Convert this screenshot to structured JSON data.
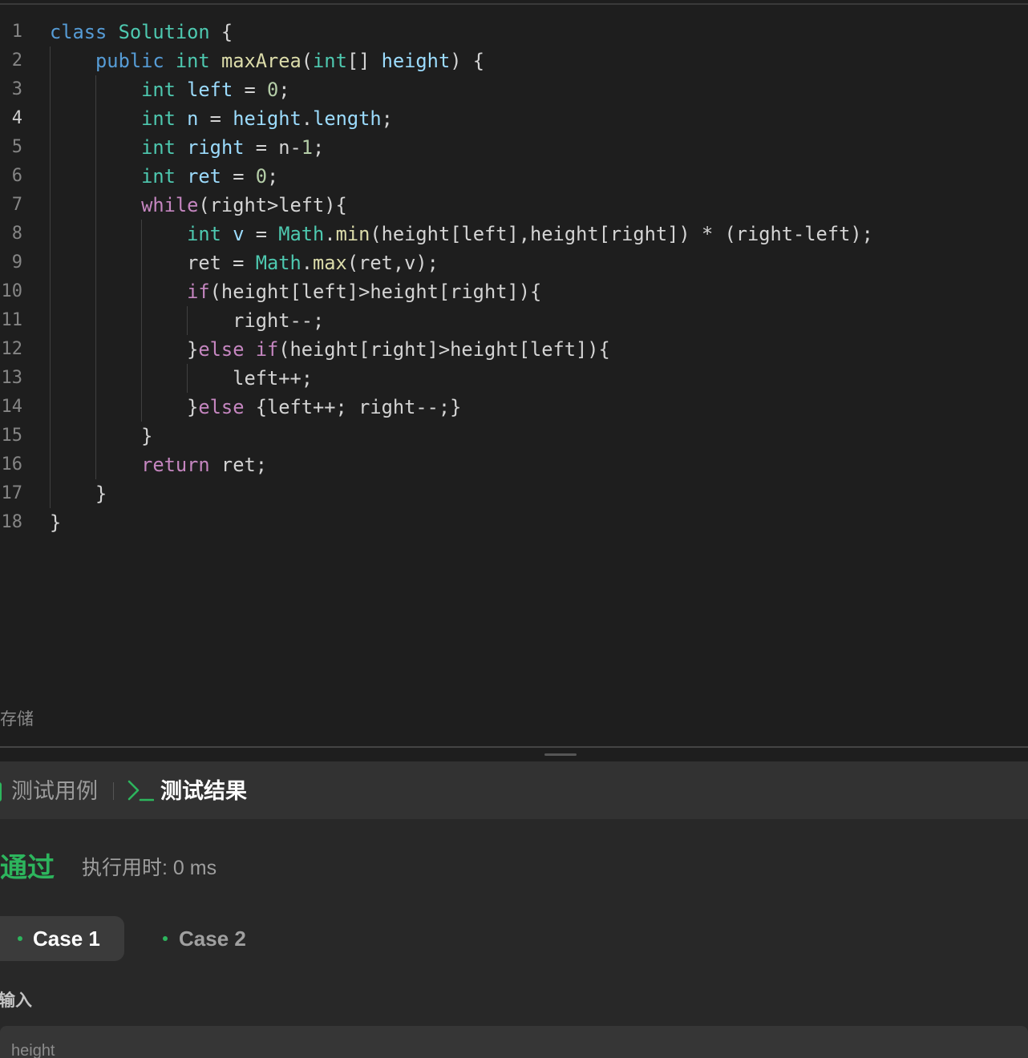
{
  "editor": {
    "line_numbers": [
      "1",
      "2",
      "3",
      "4",
      "5",
      "6",
      "7",
      "8",
      "9",
      "10",
      "11",
      "12",
      "13",
      "14",
      "15",
      "16",
      "17",
      "18"
    ],
    "active_line": 4,
    "lines": [
      [
        {
          "t": "class",
          "c": "keyword"
        },
        {
          "t": " "
        },
        {
          "t": "Solution",
          "c": "type"
        },
        {
          "t": " {"
        }
      ],
      [
        {
          "t": "    "
        },
        {
          "t": "public",
          "c": "keyword"
        },
        {
          "t": " "
        },
        {
          "t": "int",
          "c": "type"
        },
        {
          "t": " "
        },
        {
          "t": "maxArea",
          "c": "function"
        },
        {
          "t": "("
        },
        {
          "t": "int",
          "c": "type"
        },
        {
          "t": "[] "
        },
        {
          "t": "height",
          "c": "variable"
        },
        {
          "t": ") {"
        }
      ],
      [
        {
          "t": "        "
        },
        {
          "t": "int",
          "c": "type"
        },
        {
          "t": " "
        },
        {
          "t": "left",
          "c": "variable"
        },
        {
          "t": " = "
        },
        {
          "t": "0",
          "c": "number"
        },
        {
          "t": ";"
        }
      ],
      [
        {
          "t": "        "
        },
        {
          "t": "int",
          "c": "type"
        },
        {
          "t": " "
        },
        {
          "t": "n",
          "c": "variable"
        },
        {
          "t": " = "
        },
        {
          "t": "height",
          "c": "variable"
        },
        {
          "t": "."
        },
        {
          "t": "length",
          "c": "variable"
        },
        {
          "t": ";"
        }
      ],
      [
        {
          "t": "        "
        },
        {
          "t": "int",
          "c": "type"
        },
        {
          "t": " "
        },
        {
          "t": "right",
          "c": "variable"
        },
        {
          "t": " = n-"
        },
        {
          "t": "1",
          "c": "number"
        },
        {
          "t": ";"
        }
      ],
      [
        {
          "t": "        "
        },
        {
          "t": "int",
          "c": "type"
        },
        {
          "t": " "
        },
        {
          "t": "ret",
          "c": "variable"
        },
        {
          "t": " = "
        },
        {
          "t": "0",
          "c": "number"
        },
        {
          "t": ";"
        }
      ],
      [
        {
          "t": "        "
        },
        {
          "t": "while",
          "c": "control"
        },
        {
          "t": "(right>left){"
        }
      ],
      [
        {
          "t": "            "
        },
        {
          "t": "int",
          "c": "type"
        },
        {
          "t": " "
        },
        {
          "t": "v",
          "c": "variable"
        },
        {
          "t": " = "
        },
        {
          "t": "Math",
          "c": "type"
        },
        {
          "t": "."
        },
        {
          "t": "min",
          "c": "function"
        },
        {
          "t": "(height[left],height[right]) * (right-left);"
        }
      ],
      [
        {
          "t": "            ret = "
        },
        {
          "t": "Math",
          "c": "type"
        },
        {
          "t": "."
        },
        {
          "t": "max",
          "c": "function"
        },
        {
          "t": "(ret,v);"
        }
      ],
      [
        {
          "t": "            "
        },
        {
          "t": "if",
          "c": "control"
        },
        {
          "t": "(height[left]>height[right]){"
        }
      ],
      [
        {
          "t": "                right--;"
        }
      ],
      [
        {
          "t": "            }"
        },
        {
          "t": "else",
          "c": "control"
        },
        {
          "t": " "
        },
        {
          "t": "if",
          "c": "control"
        },
        {
          "t": "(height[right]>height[left]){"
        }
      ],
      [
        {
          "t": "                left++;"
        }
      ],
      [
        {
          "t": "            }"
        },
        {
          "t": "else",
          "c": "control"
        },
        {
          "t": " {left++; right--;}"
        }
      ],
      [
        {
          "t": "        }"
        }
      ],
      [
        {
          "t": "        "
        },
        {
          "t": "return",
          "c": "control"
        },
        {
          "t": " ret;"
        }
      ],
      [
        {
          "t": "    }"
        }
      ],
      [
        {
          "t": "}"
        }
      ]
    ]
  },
  "status_bar": {
    "save_label": "存储"
  },
  "result_panel": {
    "tabs": [
      {
        "label": "测试用例",
        "icon": "checkbox-icon",
        "active": false
      },
      {
        "label": "测试结果",
        "icon": "terminal-icon",
        "active": true
      }
    ],
    "verdict": "通过",
    "runtime": "执行用时: 0 ms",
    "cases": [
      {
        "label": "Case 1",
        "selected": true,
        "status": "passed"
      },
      {
        "label": "Case 2",
        "selected": false,
        "status": "passed"
      }
    ],
    "input_label": "输入",
    "input_variable": "height"
  },
  "colors": {
    "keyword": "#569cd6",
    "type": "#4ec9b0",
    "function": "#dcdcaa",
    "variable": "#9cdcfe",
    "number": "#b5cea8",
    "control": "#c586c0",
    "plain": "#d4d4d4",
    "accent_green": "#2db55d"
  }
}
